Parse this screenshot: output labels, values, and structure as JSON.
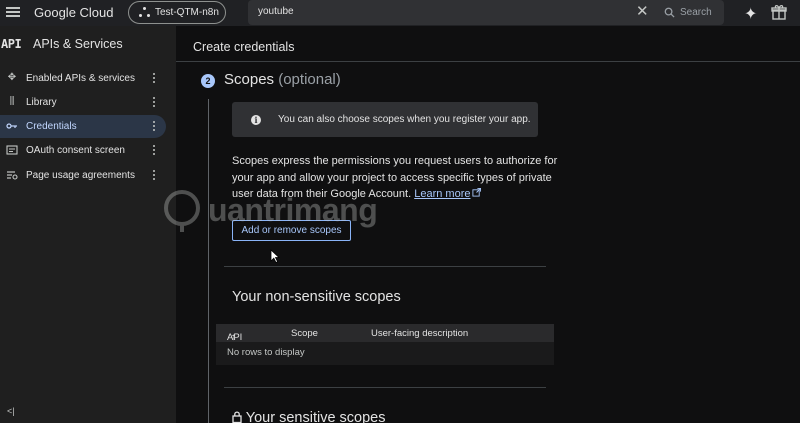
{
  "topbar": {
    "brand": "Google Cloud",
    "project": "Test-QTM-n8n",
    "search_value": "youtube",
    "search_button": "Search",
    "clear_icon": "close-icon",
    "gemini_icon": "sparkle-icon",
    "gift_icon": "gift-icon"
  },
  "sidebar": {
    "api_logo": "API",
    "title": "APIs & Services",
    "items": [
      {
        "label": "Enabled APIs & services",
        "icon": "diamond-nodes-icon",
        "active": false
      },
      {
        "label": "Library",
        "icon": "library-icon",
        "active": false
      },
      {
        "label": "Credentials",
        "icon": "key-icon",
        "active": true
      },
      {
        "label": "OAuth consent screen",
        "icon": "consent-icon",
        "active": false
      },
      {
        "label": "Page usage agreements",
        "icon": "agreement-icon",
        "active": false
      }
    ],
    "collapse_label": "<|"
  },
  "main": {
    "page_title": "Create credentials",
    "step": {
      "number": "2",
      "title": "Scopes",
      "optional": "(optional)"
    },
    "info_text": "You can also choose scopes when you register your app.",
    "description": "Scopes express the permissions you request users to authorize for your app and allow your project to access specific types of private user data from their Google Account.",
    "learn_more": "Learn more",
    "add_scopes_button": "Add or remove scopes",
    "non_sensitive_title": "Your non-sensitive scopes",
    "table": {
      "columns": [
        "API",
        "Scope",
        "User-facing description"
      ],
      "sort_indicator": "↑",
      "empty_text": "No rows to display"
    },
    "sensitive_title": "Your sensitive scopes"
  },
  "watermark": {
    "text": "uantrimang"
  },
  "colors": {
    "accent": "#a8c7fa",
    "active_bg": "#2b3647",
    "page_bg": "#0f0f10",
    "sidebar_bg": "#1f1f1f"
  }
}
